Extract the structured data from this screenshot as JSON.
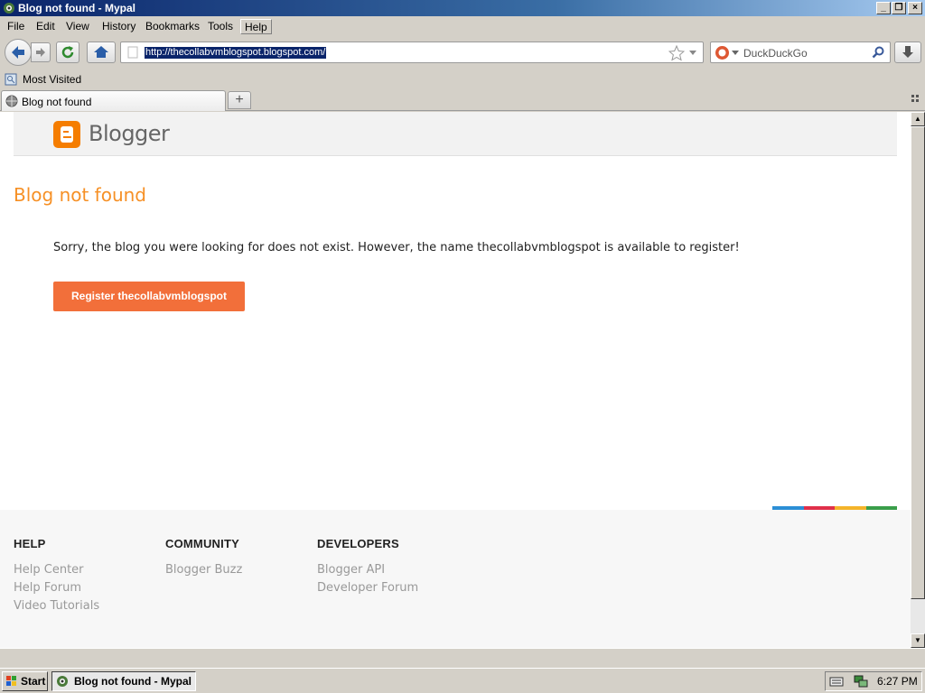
{
  "window": {
    "title": "Blog not found - Mypal"
  },
  "menu": [
    "File",
    "Edit",
    "View",
    "History",
    "Bookmarks",
    "Tools",
    "Help"
  ],
  "nav": {
    "url": "http://thecollabvmblogspot.blogspot.com/",
    "search_placeholder": "DuckDuckGo"
  },
  "bookmarks": {
    "most_visited": "Most Visited"
  },
  "tabs": [
    {
      "label": "Blog not found"
    }
  ],
  "page": {
    "brand": "Blogger",
    "heading": "Blog not found",
    "message": "Sorry, the blog you were looking for does not exist. However, the name thecollabvmblogspot is available to register!",
    "register_button": "Register thecollabvmblogspot"
  },
  "footer": {
    "help": {
      "title": "HELP",
      "links": [
        "Help Center",
        "Help Forum",
        "Video Tutorials"
      ]
    },
    "community": {
      "title": "COMMUNITY",
      "links": [
        "Blogger Buzz"
      ]
    },
    "developers": {
      "title": "DEVELOPERS",
      "links": [
        "Blogger API",
        "Developer Forum"
      ]
    }
  },
  "taskbar": {
    "start": "Start",
    "task": "Blog not found - Mypal",
    "clock": "6:27 PM"
  },
  "colors": {
    "accent": "#f57d00",
    "button": "#f26f3a",
    "stripe": [
      "#2c8fd6",
      "#e0304a",
      "#f4b42a",
      "#3a9e4a"
    ]
  }
}
